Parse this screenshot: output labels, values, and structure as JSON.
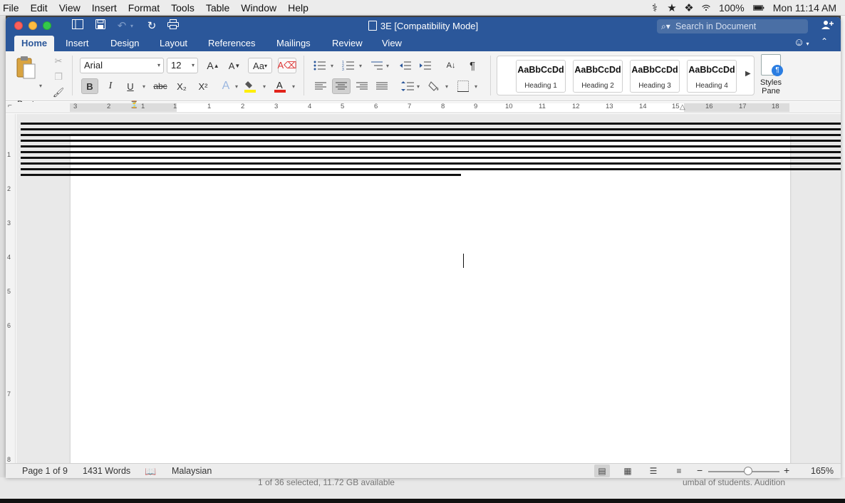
{
  "menubar": {
    "apple": "",
    "items": [
      "File",
      "Edit",
      "View",
      "Insert",
      "Format",
      "Tools",
      "Table",
      "Window",
      "Help"
    ],
    "battery": "100%",
    "clock": "Mon 11:14 AM"
  },
  "window": {
    "title": "3E [Compatibility Mode]",
    "search_placeholder": "Search in Document"
  },
  "tabs": [
    "Home",
    "Insert",
    "Design",
    "Layout",
    "References",
    "Mailings",
    "Review",
    "View"
  ],
  "active_tab": "Home",
  "ribbon": {
    "paste_label": "Paste",
    "font_name": "Arial",
    "font_size": "12",
    "bold": "B",
    "italic": "I",
    "underline": "U",
    "strikethrough": "abc",
    "subscript": "X₂",
    "superscript": "X²",
    "styles": [
      {
        "sample": "AaBbCcDd",
        "name": "Heading 1"
      },
      {
        "sample": "AaBbCcDd",
        "name": "Heading 2"
      },
      {
        "sample": "AaBbCcDd",
        "name": "Heading 3"
      },
      {
        "sample": "AaBbCcDd",
        "name": "Heading 4"
      }
    ],
    "styles_pane_label_1": "Styles",
    "styles_pane_label_2": "Pane",
    "highlight_color": "#ffee00",
    "font_color": "#e2231a"
  },
  "ruler": {
    "numbers": [
      "3",
      "2",
      "1",
      "1",
      "1",
      "2",
      "3",
      "4",
      "5",
      "6",
      "7",
      "8",
      "9",
      "10",
      "11",
      "12",
      "13",
      "14",
      "15",
      "16",
      "17",
      "18"
    ]
  },
  "vruler": {
    "numbers": [
      "1",
      "2",
      "3",
      "4",
      "5",
      "6",
      "7",
      "8"
    ]
  },
  "status": {
    "page": "Page 1 of 9",
    "words": "1431 Words",
    "language": "Malaysian",
    "zoom": "165%",
    "zoom_level_percent": 165
  },
  "background": {
    "finder_status": "1 of 36 selected, 11.72 GB available",
    "other_text": "umbal of students. Audition"
  },
  "colors": {
    "brand": "#2b579a"
  }
}
